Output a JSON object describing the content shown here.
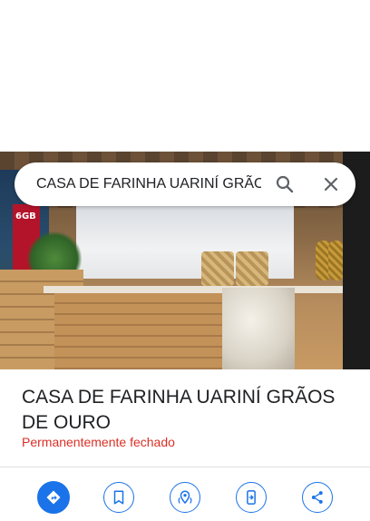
{
  "search": {
    "query": "CASA DE FARINHA UARINÍ GRÃOS D",
    "search_icon": "search-icon",
    "close_icon": "close-icon"
  },
  "hero_photo": {
    "sign_text": "6GB"
  },
  "place": {
    "title": "CASA DE FARINHA UARINÍ GRÃOS DE OURO",
    "status": "Permanentemente fechado"
  },
  "actions": [
    {
      "icon": "directions-icon"
    },
    {
      "icon": "bookmark-icon"
    },
    {
      "icon": "nearby-icon"
    },
    {
      "icon": "send-to-phone-icon"
    },
    {
      "icon": "share-icon"
    }
  ],
  "colors": {
    "accent": "#1a73e8",
    "status_red": "#d93025",
    "title": "#202124"
  }
}
